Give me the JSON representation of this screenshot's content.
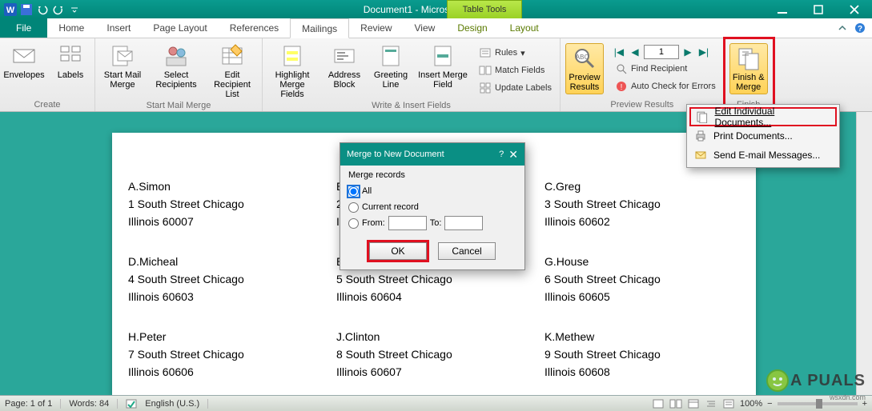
{
  "window": {
    "title": "Document1 - Microsoft Word",
    "contextual_tab_group": "Table Tools"
  },
  "tabs": {
    "file": "File",
    "home": "Home",
    "insert": "Insert",
    "page_layout": "Page Layout",
    "references": "References",
    "mailings": "Mailings",
    "review": "Review",
    "view": "View",
    "design": "Design",
    "layout": "Layout"
  },
  "ribbon": {
    "create": {
      "label": "Create",
      "envelopes": "Envelopes",
      "labels": "Labels"
    },
    "start": {
      "label": "Start Mail Merge",
      "start_mail_merge": "Start Mail\nMerge",
      "select_recipients": "Select\nRecipients",
      "edit_recipient_list": "Edit\nRecipient List"
    },
    "write": {
      "label": "Write & Insert Fields",
      "highlight": "Highlight\nMerge Fields",
      "address_block": "Address\nBlock",
      "greeting_line": "Greeting\nLine",
      "insert_merge_field": "Insert Merge\nField",
      "rules": "Rules",
      "match_fields": "Match Fields",
      "update_labels": "Update Labels"
    },
    "preview": {
      "label": "Preview Results",
      "preview_results": "Preview\nResults",
      "record_value": "1",
      "find_recipient": "Find Recipient",
      "auto_check": "Auto Check for Errors"
    },
    "finish": {
      "label": "Finish",
      "finish_merge": "Finish &\nMerge"
    }
  },
  "finish_menu": {
    "edit_individual": "Edit Individual Documents...",
    "print_documents": "Print Documents...",
    "send_email": "Send E-mail Messages..."
  },
  "dialog": {
    "title": "Merge to New Document",
    "section": "Merge records",
    "opt_all": "All",
    "opt_current": "Current record",
    "opt_from": "From:",
    "opt_to": "To:",
    "ok": "OK",
    "cancel": "Cancel"
  },
  "document": {
    "col1": [
      {
        "name": "A.Simon",
        "addr": "1 South Street Chicago",
        "zip": "Illinois 60007"
      },
      {
        "name": "D.Micheal",
        "addr": "4 South Street Chicago",
        "zip": "Illinois 60603"
      },
      {
        "name": "H.Peter",
        "addr": "7 South Street Chicago",
        "zip": "Illinois 60606"
      }
    ],
    "col2": [
      {
        "name": "E",
        "addr": "2",
        "zip": "Il"
      },
      {
        "name": "E",
        "addr": "5 South Street Chicago",
        "zip": "Illinois 60604"
      },
      {
        "name": "J.Clinton",
        "addr": "8 South Street Chicago",
        "zip": "Illinois 60607"
      }
    ],
    "col3": [
      {
        "name": "C.Greg",
        "addr": "3 South Street Chicago",
        "zip": "Illinois 60602"
      },
      {
        "name": "G.House",
        "addr": "6 South Street Chicago",
        "zip": "Illinois 60605"
      },
      {
        "name": "K.Methew",
        "addr": "9 South Street Chicago",
        "zip": "Illinois 60608"
      }
    ]
  },
  "statusbar": {
    "page": "Page: 1 of 1",
    "words": "Words: 84",
    "language": "English (U.S.)",
    "zoom": "100%"
  },
  "watermark": {
    "brand": "A  PUALS",
    "sub": "wsxdn.com"
  }
}
